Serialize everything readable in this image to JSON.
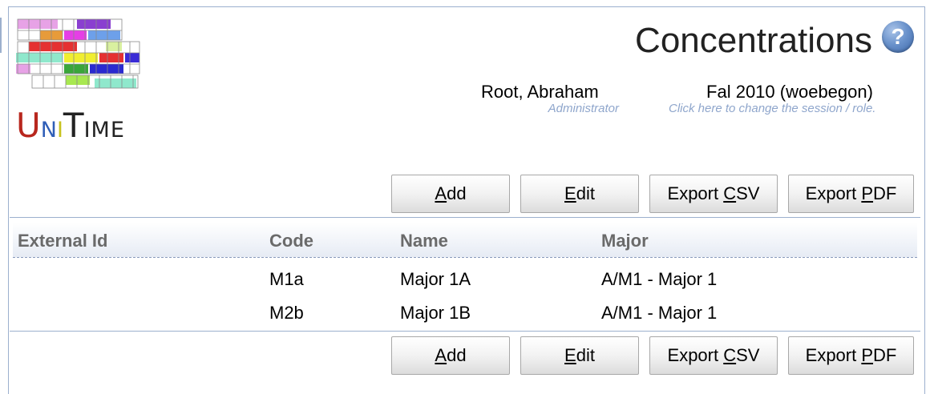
{
  "app": {
    "logo_text": {
      "u": "U",
      "n": "N",
      "i": "I",
      "t": "T",
      "ime": "IME"
    }
  },
  "header": {
    "title": "Concentrations",
    "help_icon": "question-circle-icon",
    "user_name": "Root, Abraham",
    "user_role": "Administrator",
    "session_name": "Fal 2010 (woebegon)",
    "session_hint": "Click here to change the session / role."
  },
  "buttons": {
    "add": {
      "pre": "",
      "key": "A",
      "post": "dd"
    },
    "edit": {
      "pre": "",
      "key": "E",
      "post": "dit"
    },
    "export_csv": {
      "pre": "Export ",
      "key": "C",
      "post": "SV"
    },
    "export_pdf": {
      "pre": "Export ",
      "key": "P",
      "post": "DF"
    }
  },
  "table": {
    "columns": [
      "External Id",
      "Code",
      "Name",
      "Major"
    ],
    "rows": [
      {
        "external_id": "",
        "code": "M1a",
        "name": "Major 1A",
        "major": "A/M1 - Major 1"
      },
      {
        "external_id": "",
        "code": "M2b",
        "name": "Major 1B",
        "major": "A/M1 - Major 1"
      }
    ]
  },
  "colors": {
    "border": "#9cb0ce",
    "hint": "#8fa6cc",
    "header_text": "#6a6a6a"
  }
}
